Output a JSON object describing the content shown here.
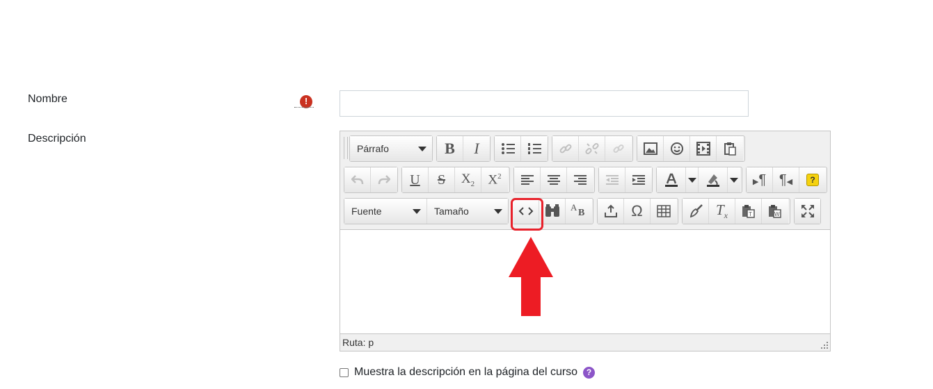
{
  "form": {
    "name_label": "Nombre",
    "required_icon": "!",
    "name_value": "",
    "description_label": "Descripción"
  },
  "editor": {
    "paragraph_select": "Párrafo",
    "font_select": "Fuente",
    "size_select": "Tamaño",
    "status_path": "Ruta: p",
    "help_icon": "?",
    "icons": [
      "bold-icon",
      "italic-icon",
      "bullet-list-icon",
      "numbered-list-icon",
      "link-icon",
      "unlink-icon",
      "anchor-icon",
      "image-icon",
      "emoticon-icon",
      "media-icon",
      "paste-icon",
      "undo-icon",
      "redo-icon",
      "underline-icon",
      "strikethrough-icon",
      "subscript-icon",
      "superscript-icon",
      "align-left-icon",
      "align-center-icon",
      "align-right-icon",
      "outdent-icon",
      "indent-icon",
      "text-color-icon",
      "background-color-icon",
      "ltr-icon",
      "rtl-icon",
      "help-icon",
      "source-code-icon",
      "search-replace-icon",
      "spellcheck-icon",
      "moodle-media-icon",
      "special-char-icon",
      "table-icon",
      "clear-format-icon",
      "remove-format-icon",
      "paste-text-icon",
      "paste-word-icon",
      "fullscreen-icon"
    ],
    "glyphs": {
      "bold": "B",
      "italic": "I",
      "underline": "U",
      "strike": "S",
      "sub": "X",
      "sub_index": "2",
      "sup": "X",
      "sup_index": "2",
      "omega": "Ω",
      "clear": "T",
      "clear_index": "x",
      "spell_a": "A",
      "spell_b": "B",
      "ltr": "¶",
      "rtl": "¶",
      "help": "?"
    }
  },
  "annotation": {
    "highlight_color": "#e8212b"
  },
  "show_description": {
    "label": "Muestra la descripción en la página del curso",
    "checked": false,
    "help": "?"
  }
}
